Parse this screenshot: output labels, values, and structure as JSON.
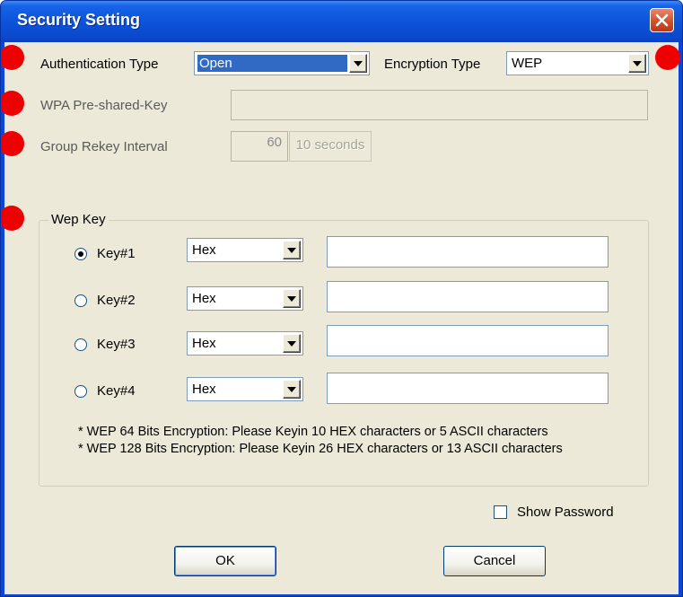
{
  "window": {
    "title": "Security Setting"
  },
  "auth": {
    "label": "Authentication Type",
    "value": "Open"
  },
  "encryption": {
    "label": "Encryption Type",
    "value": "WEP"
  },
  "wpa": {
    "label": "WPA Pre-shared-Key",
    "value": ""
  },
  "rekey": {
    "label": "Group Rekey Interval",
    "value": "60",
    "unit": "10 seconds"
  },
  "wep": {
    "legend": "Wep Key",
    "keys": [
      {
        "label": "Key#1",
        "format": "Hex",
        "value": "",
        "selected": true
      },
      {
        "label": "Key#2",
        "format": "Hex",
        "value": "",
        "selected": false
      },
      {
        "label": "Key#3",
        "format": "Hex",
        "value": "",
        "selected": false
      },
      {
        "label": "Key#4",
        "format": "Hex",
        "value": "",
        "selected": false
      }
    ],
    "notes": [
      "* WEP 64 Bits Encryption:  Please Keyin 10 HEX characters or 5 ASCII characters",
      "* WEP 128 Bits Encryption:  Please Keyin 26 HEX characters or 13 ASCII characters"
    ]
  },
  "show_password": {
    "label": "Show Password",
    "checked": false
  },
  "buttons": {
    "ok": "OK",
    "cancel": "Cancel"
  },
  "colors": {
    "titlebar": "#0a48cc",
    "dialog_bg": "#ece9d8",
    "marker": "#ee0000",
    "selection": "#316ac5"
  }
}
